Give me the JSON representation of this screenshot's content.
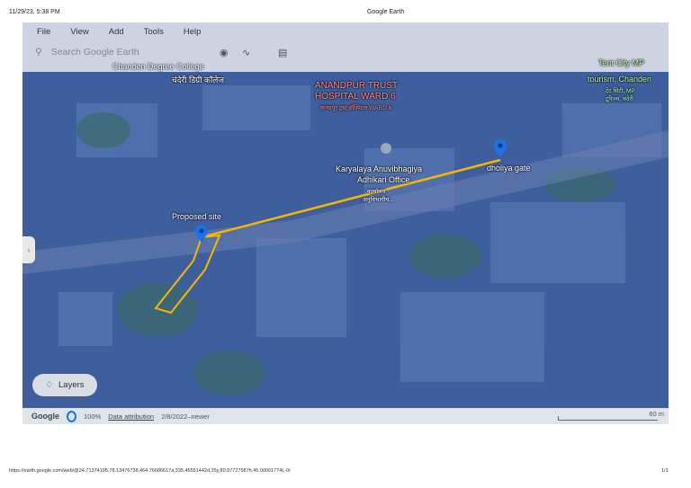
{
  "print_header": {
    "datetime": "11/29/23, 5:38 PM",
    "title": "Google Earth"
  },
  "menu": [
    "File",
    "View",
    "Add",
    "Tools",
    "Help"
  ],
  "search": {
    "placeholder": "Search Google Earth"
  },
  "icons": [
    "search-icon",
    "pin-icon",
    "path-icon",
    "ruler-icon"
  ],
  "map_labels": {
    "college": "Chanden Degree College",
    "college_hi": "चंदेरी डिग्री कॉलेज",
    "hospital_1": "ANANDPUR TRUST",
    "hospital_2": "HOSPITAL WARD 6",
    "hospital_hi": "आनंदपुर ट्रस्ट हॉस्पिटल WARD 6",
    "office_1": "Karyalaya Anuvibhagiya",
    "office_2": "Adhikari Office",
    "office_hi_1": "कार्यालय",
    "office_hi_2": "अनुविभागीय...",
    "tent_1": "Tent City MP",
    "tent_2": "tourism, Chanden",
    "tent_hi_1": "टेंट सिटी, MP",
    "tent_hi_2": "टूरिज्म, चंदेरी",
    "proposed": "Proposed site",
    "gate": "dholiya gate"
  },
  "layers_label": "Layers",
  "footer": {
    "brand": "Google",
    "zoom": "100%",
    "attribution": "Data attribution",
    "date": "2/8/2022–newer",
    "scale": "60 m"
  },
  "print_footer": {
    "url": "https://earth.google.com/web/@24.71374195,78.13476738,464.76686617a,335.45551442d,35y,80.97727587h,45.00061774t,-0r",
    "page": "1/1"
  },
  "colors": {
    "path": "#f5b800",
    "pin": "#1a73e8"
  }
}
